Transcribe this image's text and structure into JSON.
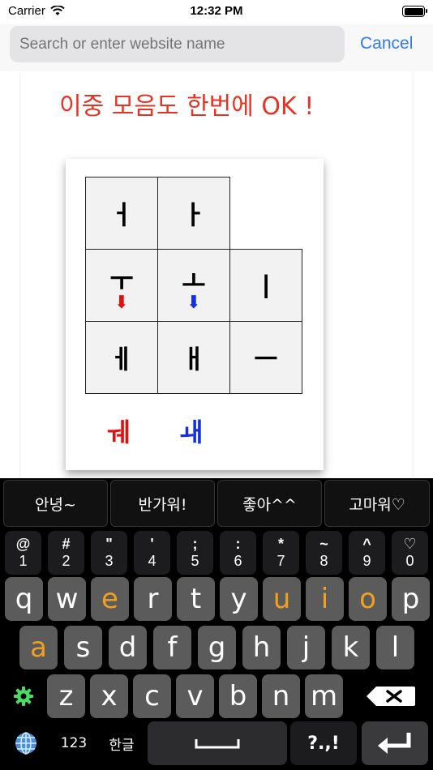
{
  "status_bar": {
    "carrier": "Carrier",
    "time": "12:32 PM"
  },
  "search": {
    "placeholder": "Search or enter website name",
    "cancel": "Cancel"
  },
  "page": {
    "headline": "이중 모음도 한번에 OK !",
    "grid": [
      {
        "char": "ㅓ"
      },
      {
        "char": "ㅏ"
      },
      {
        "char": "ㅜ",
        "arrow": "red"
      },
      {
        "char": "ㅗ",
        "arrow": "blue"
      },
      {
        "char": "ㅣ"
      },
      {
        "char": "ㅔ"
      },
      {
        "char": "ㅐ"
      },
      {
        "char": "ㅡ"
      }
    ],
    "combos": [
      {
        "char": "ㅞ",
        "color": "#e01010"
      },
      {
        "char": "ㅙ",
        "color": "#1530e0"
      }
    ]
  },
  "keyboard": {
    "phrases": [
      "안녕~",
      "반가워!",
      "좋아^^",
      "고마워♡"
    ],
    "number_row": [
      {
        "sym": "@",
        "digit": "1"
      },
      {
        "sym": "#",
        "digit": "2"
      },
      {
        "sym": "\"",
        "digit": "3"
      },
      {
        "sym": "'",
        "digit": "4"
      },
      {
        "sym": ";",
        "digit": "5"
      },
      {
        "sym": ":",
        "digit": "6"
      },
      {
        "sym": "*",
        "digit": "7"
      },
      {
        "sym": "~",
        "digit": "8"
      },
      {
        "sym": "^",
        "digit": "9"
      },
      {
        "sym": "♡",
        "digit": "0"
      }
    ],
    "row1": [
      "q",
      "w",
      "e",
      "r",
      "t",
      "y",
      "u",
      "i",
      "o",
      "p"
    ],
    "row2": [
      "a",
      "s",
      "d",
      "f",
      "g",
      "h",
      "j",
      "k",
      "l"
    ],
    "row3": [
      "z",
      "x",
      "c",
      "v",
      "b",
      "n",
      "m"
    ],
    "highlight_keys": [
      "e",
      "u",
      "i",
      "o",
      "a"
    ],
    "mode_123": "123",
    "hangul": "한글",
    "punct": "?.,!",
    "accent_color": "#f0a020",
    "icons": {
      "settings": "gear-icon",
      "globe": "globe-icon",
      "backspace": "backspace-icon",
      "return": "return-icon"
    }
  }
}
